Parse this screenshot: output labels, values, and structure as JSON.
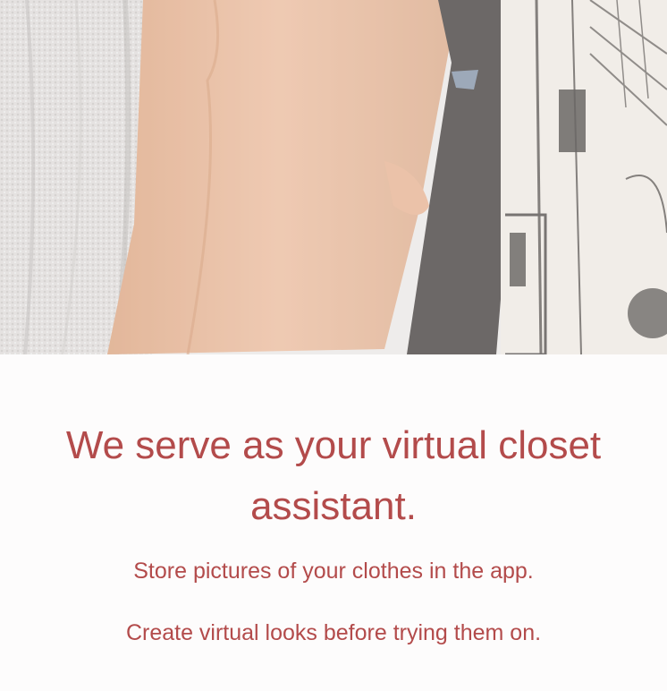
{
  "hero": {
    "image": "clothes-rack-photo"
  },
  "content": {
    "headline": "We serve as your virtual closet assistant.",
    "lines": [
      "Store pictures of your clothes in the app.",
      "Create virtual looks before trying them on."
    ],
    "text_color": "#b34b4b",
    "background": "#fdfcfc"
  }
}
